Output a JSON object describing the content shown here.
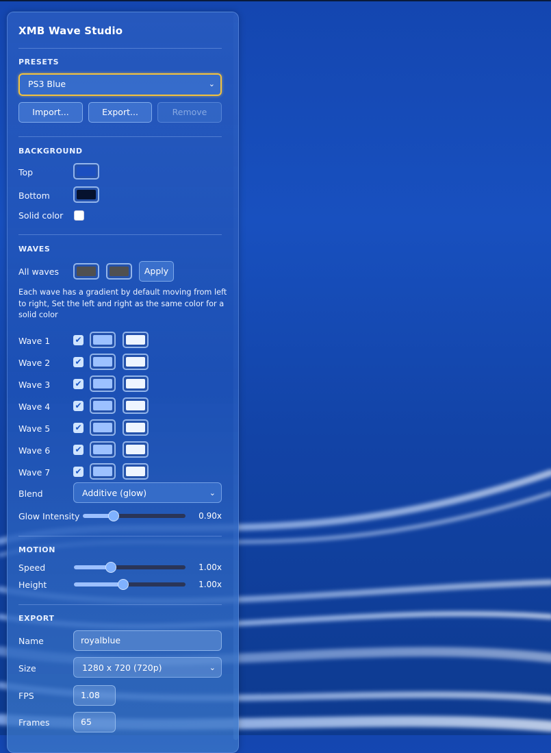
{
  "app": {
    "title": "XMB Wave Studio"
  },
  "presets": {
    "section": "PRESETS",
    "selected": "PS3 Blue",
    "import_label": "Import...",
    "export_label": "Export...",
    "remove_label": "Remove"
  },
  "background": {
    "section": "BACKGROUND",
    "top_label": "Top",
    "top_color": "#1c4fc0",
    "bottom_label": "Bottom",
    "bottom_color": "#06122e",
    "solid_label": "Solid color",
    "solid_checked": false
  },
  "waves": {
    "section": "WAVES",
    "all_label": "All waves",
    "all_left_color": "#505050",
    "all_right_color": "#505050",
    "apply_label": "Apply",
    "note": "Each wave has a gradient by default moving from left to right, Set the left and right as the same color for a solid color",
    "items": [
      {
        "label": "Wave 1",
        "enabled": true,
        "left": "#9cc1ff",
        "right": "#eef5ff"
      },
      {
        "label": "Wave 2",
        "enabled": true,
        "left": "#9cc1ff",
        "right": "#eef5ff"
      },
      {
        "label": "Wave 3",
        "enabled": true,
        "left": "#9cc1ff",
        "right": "#eef5ff"
      },
      {
        "label": "Wave 4",
        "enabled": true,
        "left": "#9cc1ff",
        "right": "#eef5ff"
      },
      {
        "label": "Wave 5",
        "enabled": true,
        "left": "#9cc1ff",
        "right": "#eef5ff"
      },
      {
        "label": "Wave 6",
        "enabled": true,
        "left": "#9cc1ff",
        "right": "#eef5ff"
      },
      {
        "label": "Wave 7",
        "enabled": true,
        "left": "#9cc1ff",
        "right": "#eef5ff"
      }
    ],
    "blend_label": "Blend",
    "blend_value": "Additive (glow)",
    "glow_label": "Glow Intensity",
    "glow_value": "0.90x",
    "glow_level": 0.3
  },
  "motion": {
    "section": "MOTION",
    "speed_label": "Speed",
    "speed_value": "1.00x",
    "speed_level": 0.33,
    "height_label": "Height",
    "height_value": "1.00x",
    "height_level": 0.44
  },
  "export": {
    "section": "EXPORT",
    "name_label": "Name",
    "name_value": "royalblue",
    "size_label": "Size",
    "size_value": "1280 x 720 (720p)",
    "fps_label": "FPS",
    "fps_value": "1.08",
    "frames_label": "Frames",
    "frames_value": "65"
  }
}
